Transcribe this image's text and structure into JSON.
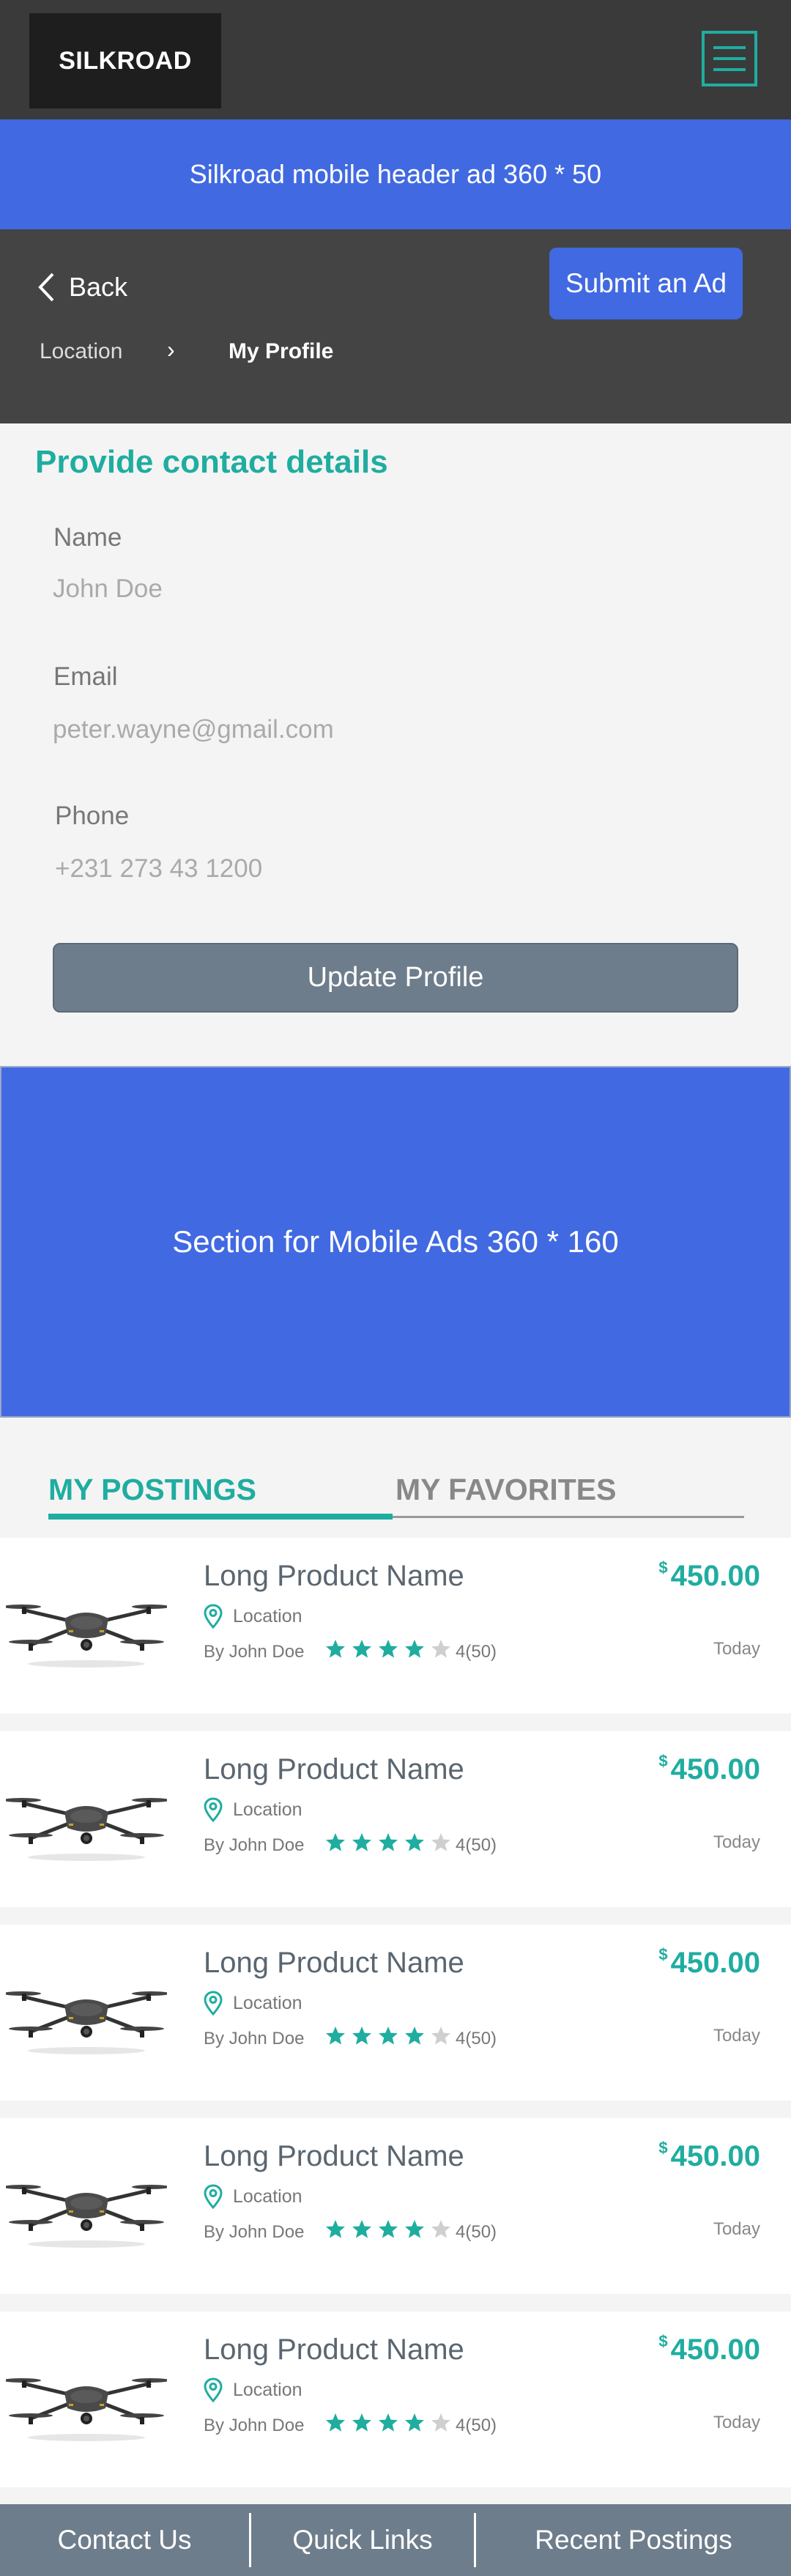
{
  "header": {
    "logo": "SILKROAD",
    "menu_icon": "hamburger-menu-icon",
    "ad_text": "Silkroad mobile header ad 360 * 50"
  },
  "nav": {
    "back_label": "Back",
    "submit_label": "Submit an Ad",
    "breadcrumb": {
      "location": "Location",
      "separator": "›",
      "current": "My Profile"
    }
  },
  "contact": {
    "title": "Provide contact details",
    "name_label": "Name",
    "name_value": "John Doe",
    "email_label": "Email",
    "email_value": "peter.wayne@gmail.com",
    "phone_label": "Phone",
    "phone_value": "+231 273 43 1200",
    "update_label": "Update Profile"
  },
  "mid_ad": {
    "text": "Section for Mobile Ads 360 * 160"
  },
  "tabs": {
    "postings": "MY POSTINGS",
    "favorites": "MY FAVORITES"
  },
  "listings": [
    {
      "name": "Long Product Name",
      "location": "Location",
      "by": "By John Doe",
      "rating": "4(50)",
      "stars": 4,
      "currency": "$",
      "price": "450.00",
      "date": "Today"
    },
    {
      "name": "Long Product Name",
      "location": "Location",
      "by": "By John Doe",
      "rating": "4(50)",
      "stars": 4,
      "currency": "$",
      "price": "450.00",
      "date": "Today"
    },
    {
      "name": "Long Product Name",
      "location": "Location",
      "by": "By John Doe",
      "rating": "4(50)",
      "stars": 4,
      "currency": "$",
      "price": "450.00",
      "date": "Today"
    },
    {
      "name": "Long Product Name",
      "location": "Location",
      "by": "By John Doe",
      "rating": "4(50)",
      "stars": 4,
      "currency": "$",
      "price": "450.00",
      "date": "Today"
    },
    {
      "name": "Long Product Name",
      "location": "Location",
      "by": "By John Doe",
      "rating": "4(50)",
      "stars": 4,
      "currency": "$",
      "price": "450.00",
      "date": "Today"
    }
  ],
  "footer": {
    "contact": "Contact Us",
    "quick_links": "Quick Links",
    "recent": "Recent Postings"
  },
  "colors": {
    "accent": "#1fada0",
    "ad_blue": "#4169e1",
    "header_dark": "#3a3a3a",
    "button_gray": "#6e7d8b"
  }
}
